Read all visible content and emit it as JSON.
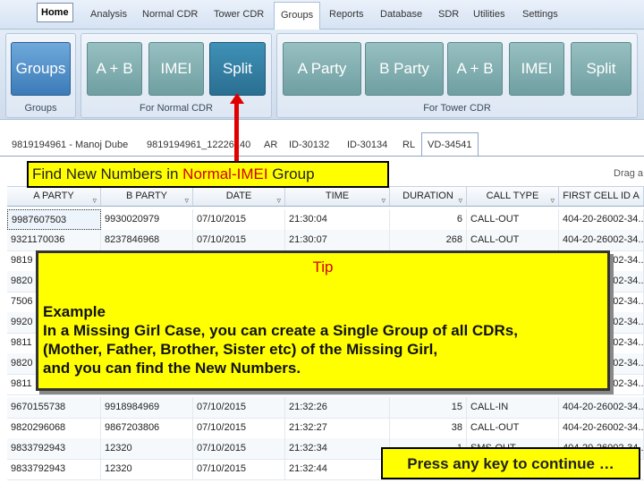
{
  "menubar": {
    "items": [
      "Home",
      "Analysis",
      "Normal CDR",
      "Tower CDR",
      "Groups",
      "Reports",
      "Database",
      "SDR",
      "Utilities",
      "Settings"
    ]
  },
  "ribbon": {
    "group1": {
      "label": "Groups",
      "buttons": [
        "Groups"
      ]
    },
    "group2": {
      "label": "For Normal CDR",
      "buttons": [
        "A + B",
        "IMEI",
        "Split"
      ]
    },
    "group3": {
      "label": "For Tower CDR",
      "buttons": [
        "A Party",
        "B Party",
        "A + B",
        "IMEI",
        "Split"
      ]
    }
  },
  "tabs": [
    "9819194961 - Manoj Dube",
    "9819194961_12226140",
    "AR",
    "ID-30132",
    "ID-30134",
    "RL",
    "VD-34541"
  ],
  "drag_hint": "Drag a",
  "grid": {
    "columns": [
      "A PARTY",
      "B PARTY",
      "DATE",
      "TIME",
      "DURATION",
      "CALL TYPE",
      "FIRST CELL ID A"
    ],
    "rows": [
      [
        "9987607503",
        "9930020979",
        "07/10/2015",
        "21:30:04",
        "6",
        "CALL-OUT",
        "404-20-26002-34..."
      ],
      [
        "9321170036",
        "8237846968",
        "07/10/2015",
        "21:30:07",
        "268",
        "CALL-OUT",
        "404-20-26002-34..."
      ],
      [
        "9819",
        "",
        "",
        "",
        "",
        "",
        "404-20-26002-34..."
      ],
      [
        "9820",
        "",
        "",
        "",
        "",
        "",
        "404-20-26002-34..."
      ],
      [
        "7506",
        "",
        "",
        "",
        "",
        "",
        "404-20-26002-34..."
      ],
      [
        "9920",
        "",
        "",
        "",
        "",
        "",
        "404-20-26002-34..."
      ],
      [
        "9811",
        "",
        "",
        "",
        "",
        "",
        "404-20-26002-34..."
      ],
      [
        "9820",
        "",
        "",
        "",
        "",
        "",
        "404-20-26002-34..."
      ],
      [
        "9811",
        "",
        "",
        "",
        "",
        "",
        "404-20-26002-34..."
      ],
      [
        "9670155738",
        "9918984969",
        "07/10/2015",
        "21:32:26",
        "15",
        "CALL-IN",
        "404-20-26002-34..."
      ],
      [
        "9820296068",
        "9867203806",
        "07/10/2015",
        "21:32:27",
        "38",
        "CALL-OUT",
        "404-20-26002-34..."
      ],
      [
        "9833792943",
        "12320",
        "07/10/2015",
        "21:32:34",
        "1",
        "SMS-OUT",
        "404-20-26002-34..."
      ],
      [
        "9833792943",
        "12320",
        "07/10/2015",
        "21:32:44",
        "",
        "",
        ""
      ]
    ]
  },
  "callout": {
    "prefix": "Find New Numbers in ",
    "highlight": "Normal-IMEI",
    "suffix": " Group"
  },
  "tip": {
    "title": "Tip",
    "lines": [
      "Example",
      "In a Missing Girl Case, you can create a Single Group of all CDRs,",
      "(Mother, Father, Brother, Sister etc) of the Missing Girl,",
      "and you can find the New Numbers."
    ]
  },
  "press_key": "Press any key to continue …"
}
